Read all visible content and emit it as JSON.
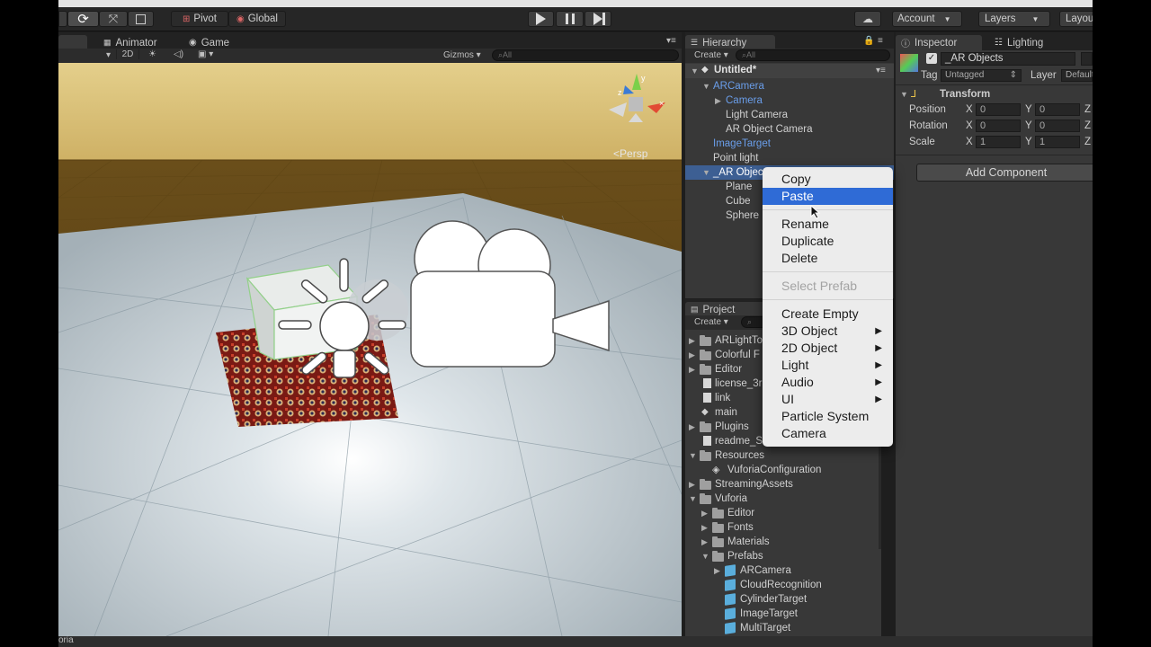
{
  "toolbar": {
    "pivot": "Pivot",
    "global": "Global",
    "account": "Account",
    "layers": "Layers",
    "layout": "Layou"
  },
  "scene": {
    "tabs": [
      "Animator",
      "Game"
    ],
    "mode_2d": "2D",
    "gizmos": "Gizmos",
    "search_placeholder": "All",
    "persp": "Persp"
  },
  "hierarchy": {
    "tab": "Hierarchy",
    "create": "Create",
    "search_placeholder": "All",
    "scene_name": "Untitled*",
    "items": [
      {
        "label": "ARCamera",
        "depth": 1,
        "blue": true,
        "toggle": "open"
      },
      {
        "label": "Camera",
        "depth": 2,
        "blue": true,
        "toggle": "closed"
      },
      {
        "label": "Light Camera",
        "depth": 2
      },
      {
        "label": "AR Object Camera",
        "depth": 2
      },
      {
        "label": "ImageTarget",
        "depth": 1,
        "blue": true
      },
      {
        "label": "Point light",
        "depth": 1
      },
      {
        "label": "_AR Objec",
        "depth": 1,
        "selected": true,
        "toggle": "open"
      },
      {
        "label": "Plane",
        "depth": 2
      },
      {
        "label": "Cube",
        "depth": 2
      },
      {
        "label": "Sphere",
        "depth": 2
      }
    ]
  },
  "context_menu": {
    "items": [
      {
        "label": "Copy"
      },
      {
        "label": "Paste",
        "selected": true
      },
      {
        "sep": true
      },
      {
        "label": "Rename"
      },
      {
        "label": "Duplicate"
      },
      {
        "label": "Delete"
      },
      {
        "sep": true
      },
      {
        "label": "Select Prefab",
        "disabled": true
      },
      {
        "sep": true
      },
      {
        "label": "Create Empty"
      },
      {
        "label": "3D Object",
        "submenu": true
      },
      {
        "label": "2D Object",
        "submenu": true
      },
      {
        "label": "Light",
        "submenu": true
      },
      {
        "label": "Audio",
        "submenu": true
      },
      {
        "label": "UI",
        "submenu": true
      },
      {
        "label": "Particle System"
      },
      {
        "label": "Camera"
      }
    ]
  },
  "project": {
    "tab": "Project",
    "create": "Create",
    "items": [
      {
        "label": "ARLightTo",
        "icon": "folder",
        "depth": 0,
        "toggle": "closed"
      },
      {
        "label": "Colorful F",
        "icon": "folder",
        "depth": 0,
        "toggle": "closed"
      },
      {
        "label": "Editor",
        "icon": "folder",
        "depth": 0,
        "toggle": "closed"
      },
      {
        "label": "license_3r",
        "icon": "file",
        "depth": 0
      },
      {
        "label": "link",
        "icon": "file",
        "depth": 0
      },
      {
        "label": "main",
        "icon": "unity",
        "depth": 0
      },
      {
        "label": "Plugins",
        "icon": "folder",
        "depth": 0,
        "toggle": "closed"
      },
      {
        "label": "readme_Sl",
        "icon": "file",
        "depth": 0
      },
      {
        "label": "Resources",
        "icon": "folder",
        "depth": 0,
        "toggle": "open"
      },
      {
        "label": "VuforiaConfiguration",
        "icon": "asset",
        "depth": 1
      },
      {
        "label": "StreamingAssets",
        "icon": "folder",
        "depth": 0,
        "toggle": "closed"
      },
      {
        "label": "Vuforia",
        "icon": "folder",
        "depth": 0,
        "toggle": "open"
      },
      {
        "label": "Editor",
        "icon": "folder",
        "depth": 1,
        "toggle": "closed"
      },
      {
        "label": "Fonts",
        "icon": "folder",
        "depth": 1,
        "toggle": "closed"
      },
      {
        "label": "Materials",
        "icon": "folder",
        "depth": 1,
        "toggle": "closed"
      },
      {
        "label": "Prefabs",
        "icon": "folder",
        "depth": 1,
        "toggle": "open"
      },
      {
        "label": "ARCamera",
        "icon": "prefab",
        "depth": 2,
        "toggle": "closed"
      },
      {
        "label": "CloudRecognition",
        "icon": "prefab",
        "depth": 2
      },
      {
        "label": "CylinderTarget",
        "icon": "prefab",
        "depth": 2
      },
      {
        "label": "ImageTarget",
        "icon": "prefab",
        "depth": 2
      },
      {
        "label": "MultiTarget",
        "icon": "prefab",
        "depth": 2
      }
    ]
  },
  "inspector": {
    "tab": "Inspector",
    "lighting_tab": "Lighting",
    "object_name": "_AR Objects",
    "tag_label": "Tag",
    "tag_value": "Untagged",
    "layer_label": "Layer",
    "layer_value": "Default",
    "transform_title": "Transform",
    "rows": [
      {
        "label": "Position",
        "x": "0",
        "y": "0"
      },
      {
        "label": "Rotation",
        "x": "0",
        "y": "0"
      },
      {
        "label": "Scale",
        "x": "1",
        "y": "1"
      }
    ],
    "x_label": "X",
    "y_label": "Y",
    "z_label": "Z",
    "add_component": "Add Component"
  },
  "status": {
    "text": "oria"
  }
}
